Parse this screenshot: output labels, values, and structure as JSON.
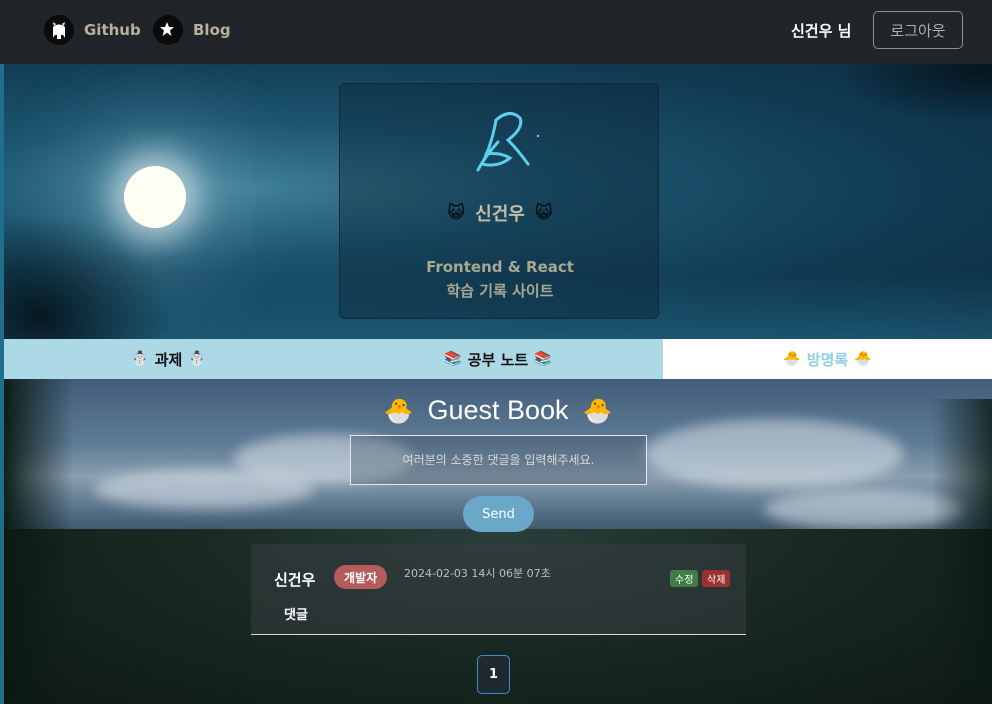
{
  "nav": {
    "github_label": "Github",
    "blog_label": "Blog",
    "user_label": "신건우 님",
    "logout_label": "로그아웃"
  },
  "profile": {
    "name": "신건우",
    "subtitle_line1": "Frontend & React",
    "subtitle_line2": "학습 기록 사이트",
    "logo_stroke_color": "#5ccfee"
  },
  "tabs": [
    {
      "label": "과제",
      "emoji": "☃️",
      "active": false
    },
    {
      "label": "공부 노트",
      "emoji": "📚",
      "active": false
    },
    {
      "label": "방명록",
      "emoji": "🐣",
      "active": true
    }
  ],
  "guestbook": {
    "title": "Guest Book",
    "title_emoji": "🐣",
    "input_placeholder": "여러분의 소중한 댓글을 입력해주세요.",
    "send_label": "Send",
    "comments": [
      {
        "author": "신건우",
        "badge": "개발자",
        "date": "2024-02-03 14시 06분 07초",
        "edit_label": "수정",
        "delete_label": "삭제",
        "body": "댓글"
      }
    ],
    "pagination": {
      "current_page": "1"
    }
  },
  "colors": {
    "navbar_bg": "#212529",
    "tab_bg": "#add8e6",
    "tab_active_text": "#8fcfe3",
    "badge_bg": "#b65b5b",
    "edit_bg": "#3e7e46",
    "delete_bg": "#9a3131",
    "send_bg": "#6aa7c9"
  }
}
